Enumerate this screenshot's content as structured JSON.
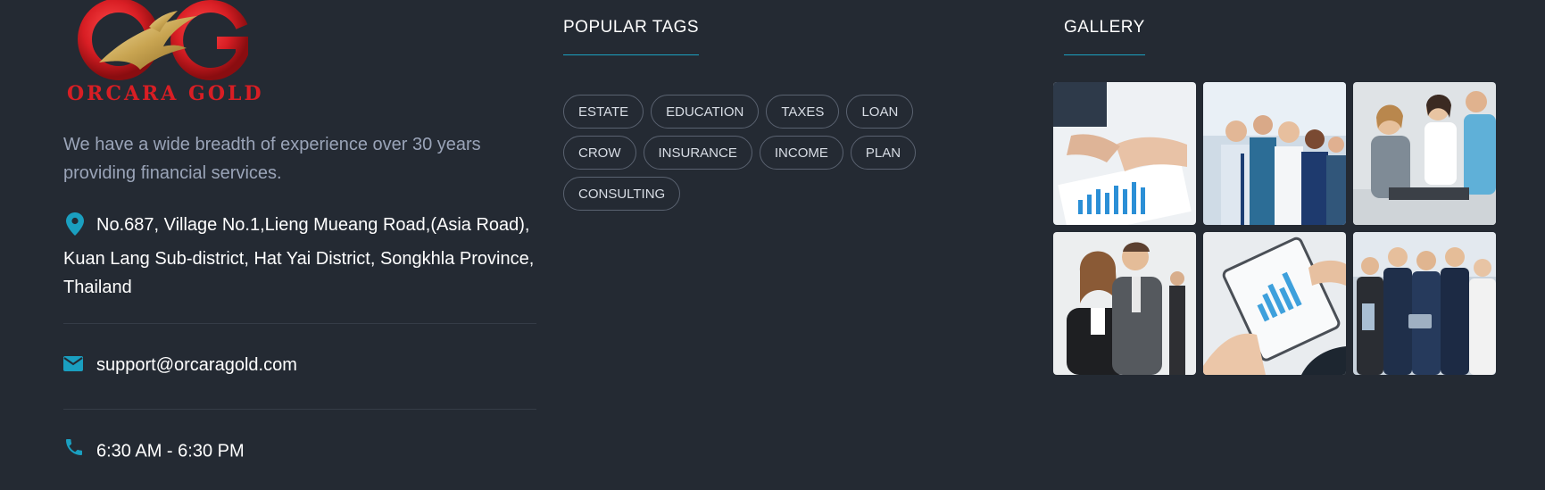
{
  "brand": {
    "logo_text": "ORCARA GOLD"
  },
  "about": {
    "description": "We have a wide breadth of experience over 30 years providing financial services."
  },
  "contact": {
    "address": "No.687, Village No.1,Lieng Mueang Road,(Asia Road), Kuan Lang Sub-district, Hat Yai District, Songkhla Province, Thailand",
    "email": "support@orcaragold.com",
    "hours": "6:30 AM - 6:30 PM",
    "icons": {
      "address": "map-pin-icon",
      "email": "envelope-icon",
      "phone": "phone-icon"
    }
  },
  "tags": {
    "title": "POPULAR TAGS",
    "items": [
      "ESTATE",
      "EDUCATION",
      "TAXES",
      "LOAN",
      "CROW",
      "INSURANCE",
      "INCOME",
      "PLAN",
      "CONSULTING"
    ]
  },
  "gallery": {
    "title": "GALLERY",
    "images": [
      "chart-document-photo",
      "team-celebration-photo",
      "office-meeting-photo",
      "businesswoman-businessman-photo",
      "clipboard-chart-photo",
      "business-team-photo"
    ]
  },
  "colors": {
    "background": "#242a33",
    "accent": "#1a9fc0",
    "muted_text": "#9aa4b8",
    "tag_border": "#5a6270",
    "logo_red": "#d81e24",
    "logo_gold": "#d4b46a"
  }
}
